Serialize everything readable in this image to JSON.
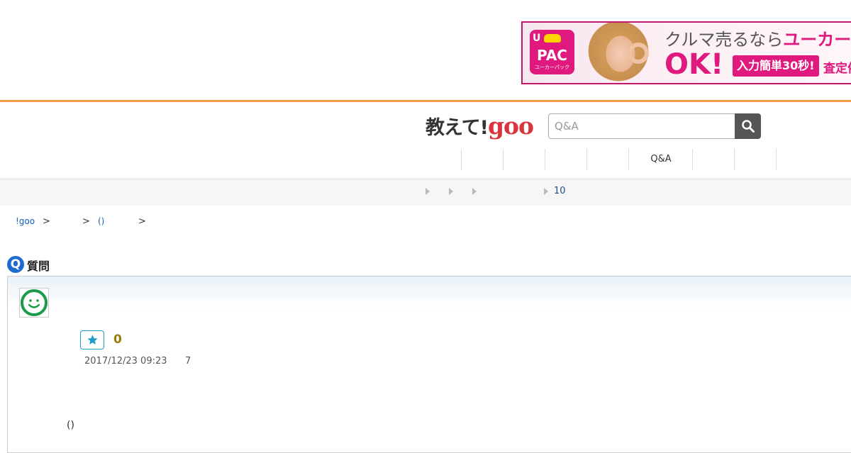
{
  "ad": {
    "logo_u": "U",
    "logo_pac": "PAC",
    "logo_small": "ユーカーパック",
    "headline_prefix": "クルマ売るなら",
    "headline_brand": "ユーカー",
    "ok_text": "OK!",
    "tag_text": "入力簡単30秒!",
    "more_text": "査定依",
    "brand_color": "#e0197e"
  },
  "header": {
    "logo_jp": "教えて!",
    "logo_goo": "goo",
    "accent_color": "#f39b4a",
    "search": {
      "placeholder": "Q&A",
      "value": "",
      "icon": "search-icon"
    }
  },
  "nav": {
    "tabs": [
      "",
      "",
      "",
      "",
      "Q&A",
      "",
      ""
    ]
  },
  "subnav": {
    "number": "10"
  },
  "breadcrumb": {
    "items": [
      "!goo",
      ">",
      ">",
      "()",
      ">"
    ]
  },
  "question": {
    "badge": "Q",
    "title": "質問",
    "avatar_icon": "smiley-icon",
    "like_icon": "star-icon",
    "like_count": "0",
    "date": "2017/12/23 09:23",
    "views": "7",
    "body": "()"
  }
}
